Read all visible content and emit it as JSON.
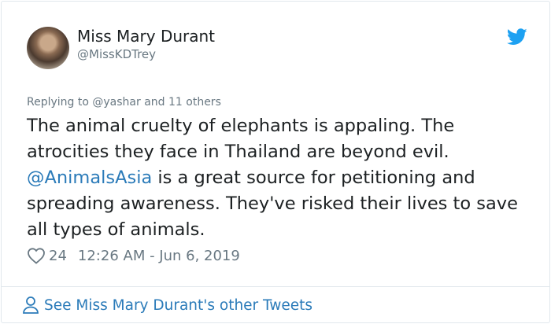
{
  "tweet": {
    "author_name": "Miss Mary Durant",
    "author_handle": "@MissKDTrey",
    "replying_prefix": "Replying to ",
    "replying_to": "@yashar",
    "replying_suffix": " and 11 others",
    "text_part1": "The animal cruelty of elephants is appaling. The atrocities they face in Thailand are beyond evil. ",
    "mention": "@AnimalsAsia",
    "text_part2": " is a great source for petitioning and spreading awareness. They've risked their lives to save all types of animals.",
    "likes": "24",
    "timestamp": "12:26 AM - Jun 6, 2019",
    "footer_link": "See Miss Mary Durant's other Tweets"
  },
  "icons": {
    "bird": "twitter-bird-icon",
    "heart": "heart-icon",
    "person": "person-icon"
  },
  "colors": {
    "link": "#2b7bb9",
    "secondary_text": "#697882",
    "brand": "#1da1f2"
  }
}
